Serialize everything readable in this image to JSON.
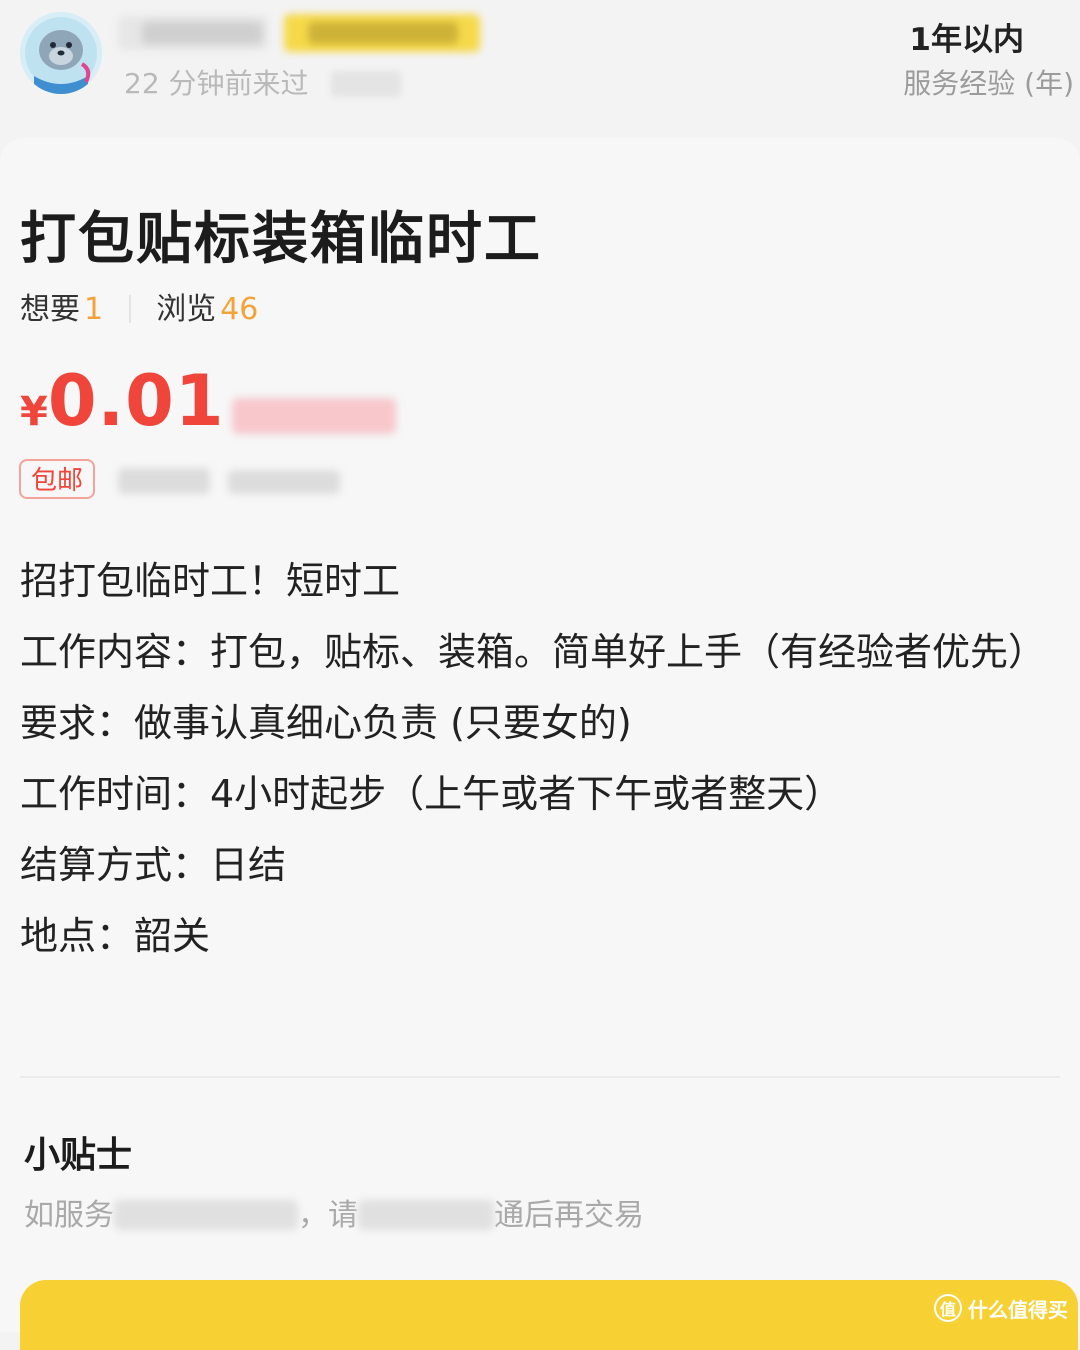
{
  "seller": {
    "last_seen": "22 分钟前来过"
  },
  "experience": {
    "value": "1年以内",
    "label": "服务经验 (年)"
  },
  "listing": {
    "title": "打包贴标装箱临时工",
    "want_label": "想要",
    "want_count": "1",
    "views_label": "浏览",
    "views_count": "46",
    "currency": "¥",
    "price": "0.01",
    "shipping_tag": "包邮"
  },
  "description": {
    "lines": [
      "招打包临时工！短时工",
      "工作内容：打包，贴标、装箱。简单好上手（有经验者优先）",
      "要求：做事认真细心负责 (只要女的)",
      "工作时间：4小时起步（上午或者下午或者整天）",
      "结算方式：日结",
      "地点：韶关"
    ]
  },
  "tips": {
    "title": "小贴士",
    "text_prefix": "如服务",
    "text_middle": "，请",
    "text_suffix": "通后再交易"
  },
  "watermark": {
    "logo_glyph": "值",
    "text": "什么值得买"
  },
  "colors": {
    "price_red": "#f0453a",
    "count_orange": "#f2a33a",
    "bottom_yellow": "#f7d133",
    "background": "#f7f7f7"
  }
}
